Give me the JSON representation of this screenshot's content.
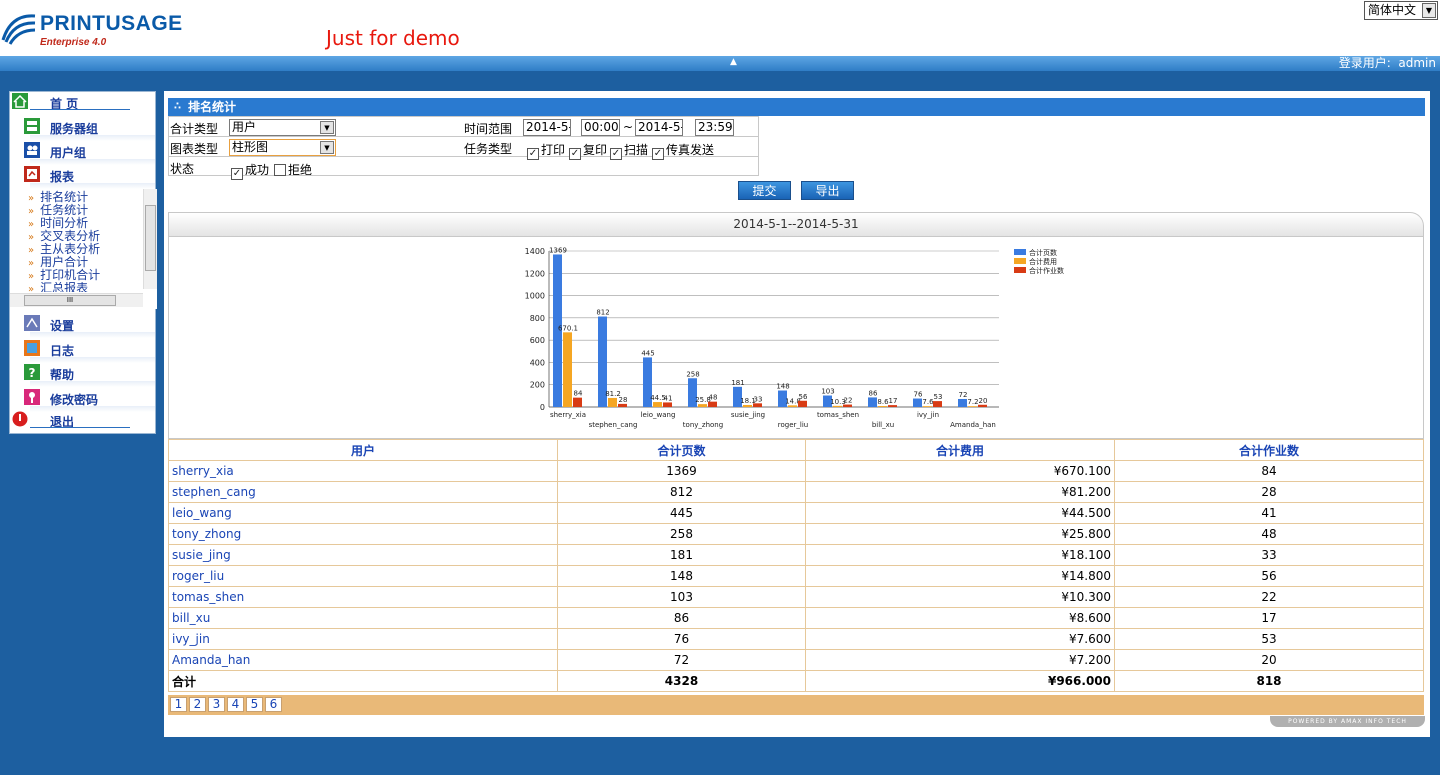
{
  "header": {
    "logo_title": "PRINTUSAGE",
    "logo_subtitle": "Enterprise 4.0",
    "demo_text": "Just for demo",
    "language": "简体中文",
    "login_label": "登录用户:",
    "login_user": "admin"
  },
  "sidebar": {
    "items": [
      {
        "label": "首 页",
        "icon": "home-icon"
      },
      {
        "label": "服务器组",
        "icon": "server-group-icon"
      },
      {
        "label": "用户组",
        "icon": "user-group-icon"
      },
      {
        "label": "报表",
        "icon": "report-icon"
      },
      {
        "label": "设置",
        "icon": "settings-icon"
      },
      {
        "label": "日志",
        "icon": "log-icon"
      },
      {
        "label": "帮助",
        "icon": "help-icon"
      },
      {
        "label": "修改密码",
        "icon": "key-icon"
      },
      {
        "label": "退出",
        "icon": "exit-icon"
      }
    ],
    "report_subitems": [
      "排名统计",
      "任务统计",
      "时间分析",
      "交叉表分析",
      "主从表分析",
      "用户合计",
      "打印机合计",
      "汇总报表"
    ]
  },
  "main": {
    "title": "排名统计",
    "filters": {
      "sum_type_label": "合计类型",
      "sum_type_value": "用户",
      "time_range_label": "时间范围",
      "date_from": "2014-5-",
      "time_from": "00:00:",
      "range_sep": "~",
      "date_to": "2014-5-",
      "time_to": "23:59:",
      "chart_type_label": "图表类型",
      "chart_type_value": "柱形图",
      "task_type_label": "任务类型",
      "task_types": [
        {
          "label": "打印",
          "checked": true
        },
        {
          "label": "复印",
          "checked": true
        },
        {
          "label": "扫描",
          "checked": true
        },
        {
          "label": "传真发送",
          "checked": true
        }
      ],
      "status_label": "状态",
      "statuses": [
        {
          "label": "成功",
          "checked": true
        },
        {
          "label": "拒绝",
          "checked": false
        }
      ]
    },
    "submit_label": "提交",
    "export_label": "导出",
    "date_range_title": "2014-5-1--2014-5-31"
  },
  "chart_data": {
    "type": "bar",
    "categories": [
      "sherry_xia",
      "stephen_cang",
      "leio_wang",
      "tony_zhong",
      "susie_jing",
      "roger_liu",
      "tomas_shen",
      "bill_xu",
      "ivy_jin",
      "Amanda_han"
    ],
    "series": [
      {
        "name": "合计页数",
        "color": "#3a7be0",
        "values": [
          1369,
          812,
          445,
          258,
          181,
          148,
          103,
          86,
          76,
          72
        ],
        "labels": [
          "1369",
          "812",
          "445",
          "258",
          "181",
          "148",
          "103",
          "86",
          "76",
          "72"
        ]
      },
      {
        "name": "合计费用",
        "color": "#f5a623",
        "values": [
          670.1,
          81.2,
          44.5,
          25.8,
          18.1,
          14.8,
          10.3,
          8.6,
          7.6,
          7.2
        ],
        "labels": [
          "670.1",
          "81.2",
          "44.5",
          "25.8",
          "18.1",
          "14.8",
          "10.3",
          "8.6",
          "7.6",
          "7.2"
        ]
      },
      {
        "name": "合计作业数",
        "color": "#d83b14",
        "values": [
          84,
          28,
          41,
          48,
          33,
          56,
          22,
          17,
          53,
          20
        ],
        "labels": [
          "84",
          "28",
          "41",
          "48",
          "33",
          "56",
          "22",
          "17",
          "53",
          "20"
        ]
      }
    ],
    "yticks": [
      "0",
      "200",
      "400",
      "600",
      "800",
      "1000",
      "1200",
      "1400"
    ],
    "ylim": [
      0,
      1400
    ],
    "legend_position": "top-right",
    "grid": true
  },
  "table": {
    "headers": [
      "用户",
      "合计页数",
      "合计费用",
      "合计作业数"
    ],
    "rows": [
      [
        "sherry_xia",
        "1369",
        "¥670.100",
        "84"
      ],
      [
        "stephen_cang",
        "812",
        "¥81.200",
        "28"
      ],
      [
        "leio_wang",
        "445",
        "¥44.500",
        "41"
      ],
      [
        "tony_zhong",
        "258",
        "¥25.800",
        "48"
      ],
      [
        "susie_jing",
        "181",
        "¥18.100",
        "33"
      ],
      [
        "roger_liu",
        "148",
        "¥14.800",
        "56"
      ],
      [
        "tomas_shen",
        "103",
        "¥10.300",
        "22"
      ],
      [
        "bill_xu",
        "86",
        "¥8.600",
        "17"
      ],
      [
        "ivy_jin",
        "76",
        "¥7.600",
        "53"
      ],
      [
        "Amanda_han",
        "72",
        "¥7.200",
        "20"
      ]
    ],
    "total": [
      "合计",
      "4328",
      "¥966.000",
      "818"
    ],
    "pages": [
      "1",
      "2",
      "3",
      "4",
      "5",
      "6"
    ]
  },
  "footer": {
    "powered": "POWERED BY AMAX INFO TECH"
  }
}
